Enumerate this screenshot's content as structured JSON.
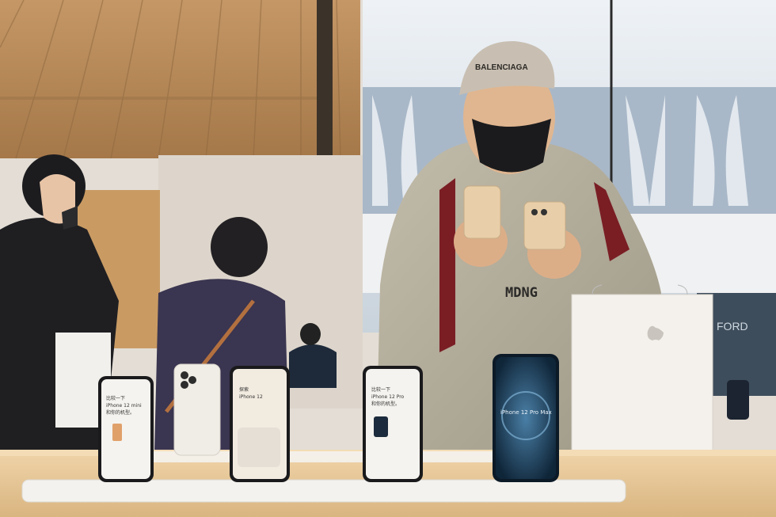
{
  "scene": {
    "description_labels": {
      "cap_text": "BALENCIAGA",
      "hoodie_text": "MDNG",
      "sign_text": "FORD"
    },
    "phones": [
      {
        "line1": "比较一下",
        "line2": "iPhone 12 mini",
        "line3": "和你的机型。"
      },
      {
        "line1": "探索",
        "line2": "iPhone 12",
        "line3": ""
      },
      {
        "line1": "比较一下",
        "line2": "iPhone 12 Pro",
        "line3": "和你的机型。"
      },
      {
        "line1": "",
        "line2": "iPhone 12 Pro Max",
        "line3": ""
      }
    ],
    "colors": {
      "ceiling": "#b98c5c",
      "wall": "#e4ddd4",
      "table": "#e6c79a",
      "hoodie": "#b9b3a1",
      "bag": "#f3f0ea"
    }
  }
}
